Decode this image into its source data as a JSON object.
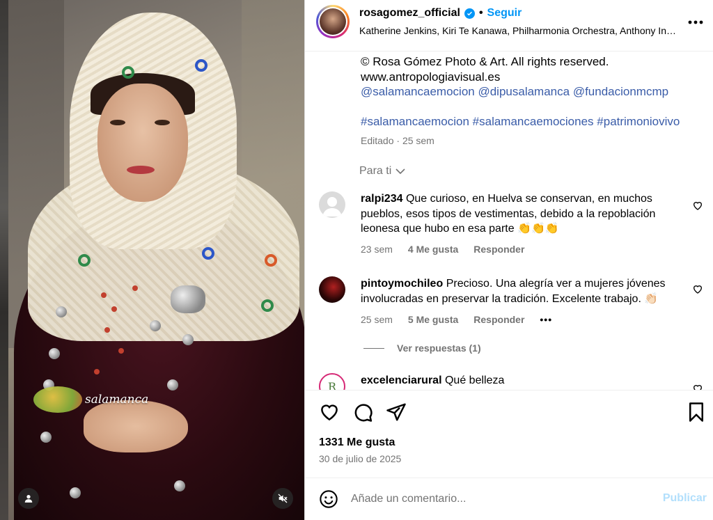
{
  "media": {
    "watermark_text": "salamanca",
    "tag_icon": "user-tag-icon",
    "mute_icon": "speaker-muted-icon"
  },
  "header": {
    "username": "rosagomez_official",
    "separator": "•",
    "follow_label": "Seguir",
    "audio": "Katherine Jenkins, Kiri Te Kanawa, Philharmonia Orchestra, Anthony Inglis · Pie Jesu",
    "more_icon": "more-horizontal-icon"
  },
  "caption": {
    "copyright": "© Rosa Gómez Photo & Art. All rights reserved.",
    "website": "www.antropologiavisual.es",
    "mentions": [
      "@salamancaemocion",
      "@dipusalamanca",
      "@fundacionmcmp"
    ],
    "hashtags": [
      "#salamancaemocion",
      "#salamancaemociones",
      "#patrimoniovivo"
    ],
    "edited": "Editado",
    "time": "25 sem"
  },
  "for_you": "Para ti",
  "comments": [
    {
      "username": "ralpi234",
      "text": "Que curioso, en Huelva se conservan, en muchos pueblos, esos tipos de vestimentas, debido a la repoblación leonesa que hubo en esa parte 👏👏👏",
      "time": "23 sem",
      "likes": "4 Me gusta",
      "reply": "Responder"
    },
    {
      "username": "pintoymochileo",
      "text": "Precioso. Una alegría ver a mujeres jóvenes involucradas en preservar la tradición. Excelente trabajo. 👏🏻",
      "time": "25 sem",
      "likes": "5 Me gusta",
      "reply": "Responder",
      "more": "•••"
    },
    {
      "username": "excelenciarural",
      "text": "Qué belleza"
    }
  ],
  "view_replies": "Ver respuestas (1)",
  "actions": {
    "likes": "1331 Me gusta",
    "date": "30 de julio de 2025"
  },
  "add_comment": {
    "placeholder": "Añade un comentario...",
    "publish_label": "Publicar"
  },
  "colors": {
    "accent": "#0095f6",
    "muted": "#737373",
    "link": "#3a5ca8",
    "publish_disabled": "#b2dffc"
  }
}
